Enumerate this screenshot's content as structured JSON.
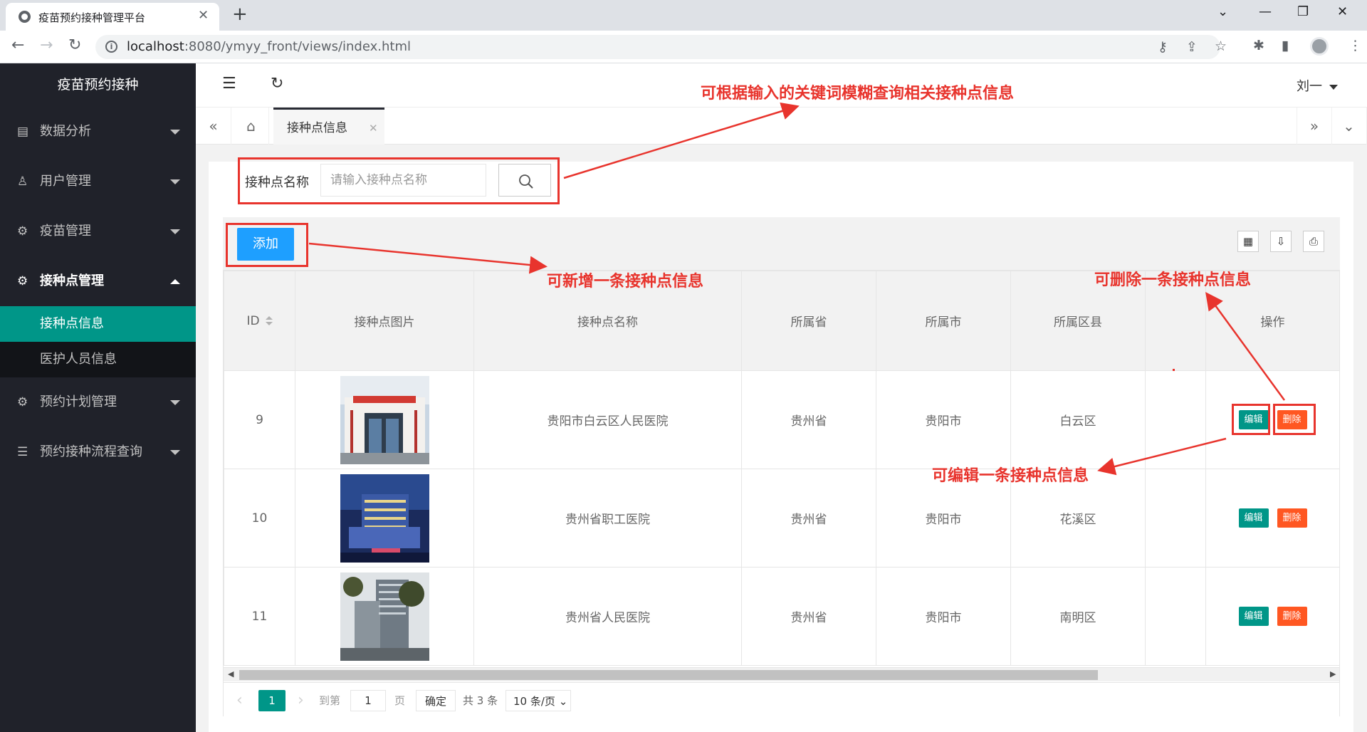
{
  "browser": {
    "tab_title": "疫苗预约接种管理平台",
    "url_host": "localhost",
    "url_rest": ":8080/ymyy_front/views/index.html"
  },
  "sidebar": {
    "logo": "疫苗预约接种",
    "menu": [
      {
        "label": "数据分析",
        "icon": "chart-icon"
      },
      {
        "label": "用户管理",
        "icon": "user-icon"
      },
      {
        "label": "疫苗管理",
        "icon": "gear-icon"
      },
      {
        "label": "接种点管理",
        "icon": "gear-icon"
      }
    ],
    "submenu": [
      "接种点信息",
      "医护人员信息"
    ],
    "menu_after": [
      {
        "label": "预约计划管理",
        "icon": "gear-icon"
      },
      {
        "label": "预约接种流程查询",
        "icon": "sliders-icon"
      }
    ]
  },
  "header": {
    "user": "刘一",
    "page_tab": "接种点信息"
  },
  "search": {
    "label": "接种点名称",
    "placeholder": "请输入接种点名称"
  },
  "toolbar": {
    "add_label": "添加"
  },
  "table": {
    "columns": [
      "ID",
      "接种点图片",
      "接种点名称",
      "所属省",
      "所属市",
      "所属区县",
      "",
      "操作"
    ],
    "rows": [
      {
        "id": "9",
        "name": "贵阳市白云区人民医院",
        "province": "贵州省",
        "city": "贵阳市",
        "district": "白云区"
      },
      {
        "id": "10",
        "name": "贵州省职工医院",
        "province": "贵州省",
        "city": "贵阳市",
        "district": "花溪区"
      },
      {
        "id": "11",
        "name": "贵州省人民医院",
        "province": "贵州省",
        "city": "贵阳市",
        "district": "南明区"
      }
    ],
    "edit_label": "编辑",
    "delete_label": "删除"
  },
  "pager": {
    "current": "1",
    "goto_label": "到第",
    "goto_value": "1",
    "page_unit": "页",
    "confirm": "确定",
    "total": "共 3 条",
    "page_size": "10 条/页"
  },
  "annotations": {
    "search": "可根据输入的关键词模糊查询相关接种点信息",
    "add": "可新增一条接种点信息",
    "delete": "可删除一条接种点信息",
    "edit": "可编辑一条接种点信息"
  },
  "colors": {
    "accent": "#009688",
    "primary_button": "#1e9fff",
    "danger": "#ff5722",
    "annotation": "#e8342d",
    "sidebar": "#20222a"
  }
}
